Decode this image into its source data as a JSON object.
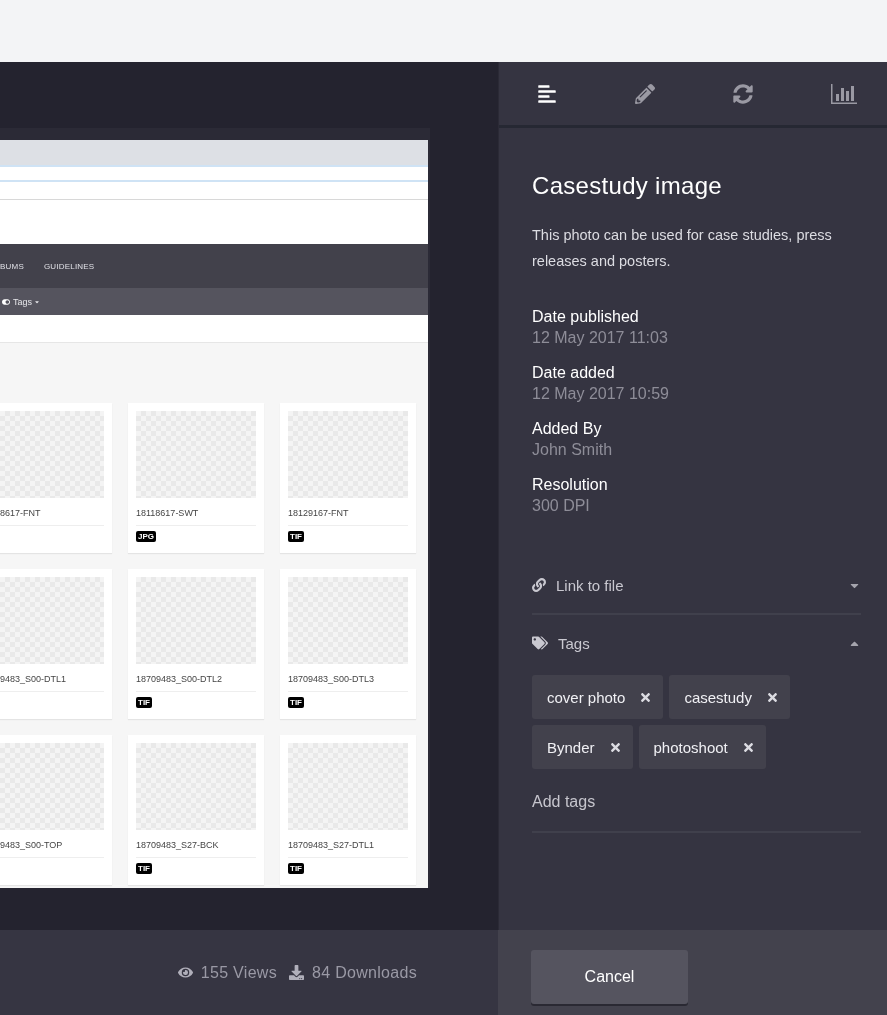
{
  "preview": {
    "nav_items": [
      "BUMS",
      "GUIDELINES"
    ],
    "filter": {
      "label": "Tags"
    },
    "cards": [
      {
        "name": "8617-FNT"
      },
      {
        "name": "18118617-SWT",
        "badge": "JPG"
      },
      {
        "name": "18129167-FNT",
        "badge": "TIF"
      },
      {
        "name": "9483_S00-DTL1"
      },
      {
        "name": "18709483_S00-DTL2",
        "badge": "TIF"
      },
      {
        "name": "18709483_S00-DTL3",
        "badge": "TIF"
      },
      {
        "name": "9483_S00-TOP"
      },
      {
        "name": "18709483_S27-BCK",
        "badge": "TIF"
      },
      {
        "name": "18709483_S27-DTL1",
        "badge": "TIF"
      }
    ]
  },
  "stats": {
    "views": "155 Views",
    "downloads": "84 Downloads"
  },
  "panel": {
    "tabs": [
      {
        "kind": "details",
        "selected": true
      },
      {
        "kind": "edit",
        "selected": false
      },
      {
        "kind": "versions",
        "selected": false
      },
      {
        "kind": "stats",
        "selected": false
      }
    ],
    "title": "Casestudy image",
    "description": "This photo can be used for case studies, press releases and posters.",
    "fields": [
      {
        "label": "Date published",
        "value": "12 May  2017 11:03"
      },
      {
        "label": "Date added",
        "value": "12 May  2017 10:59"
      },
      {
        "label": "Added By",
        "value": "John Smith"
      },
      {
        "label": "Resolution",
        "value": "300 DPI"
      }
    ],
    "sections": [
      {
        "kind": "link",
        "label": "Link to file",
        "expanded": false
      },
      {
        "kind": "tags",
        "label": "Tags",
        "expanded": true,
        "tags": [
          "cover photo",
          "casestudy",
          "Bynder",
          "photoshoot"
        ],
        "placeholder": "Add tags"
      }
    ],
    "cancel": "Cancel"
  }
}
